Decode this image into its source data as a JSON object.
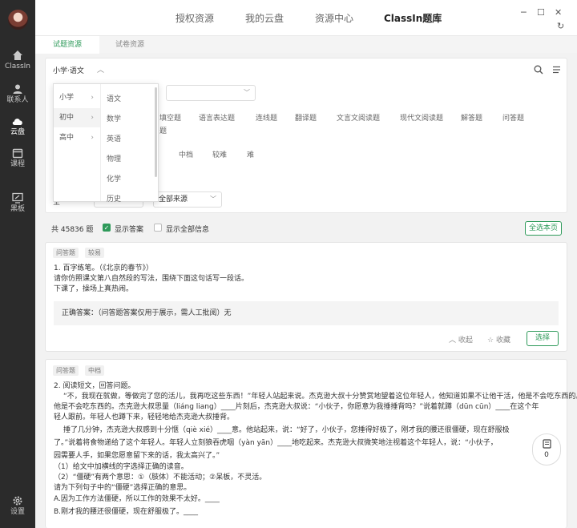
{
  "sidebar": {
    "items": [
      {
        "label": "ClassIn",
        "icon": "home-icon"
      },
      {
        "label": "联系人",
        "icon": "contacts-icon"
      },
      {
        "label": "云盘",
        "icon": "cloud-icon"
      },
      {
        "label": "课程",
        "icon": "calendar-icon"
      },
      {
        "label": "黑板",
        "icon": "blackboard-icon"
      }
    ],
    "settings": "设置"
  },
  "top_tabs": [
    "授权资源",
    "我的云盘",
    "资源中心",
    "ClassIn题库"
  ],
  "sub_tabs": [
    "试题资源",
    "试卷资源"
  ],
  "filter": {
    "selected_subject": "小学·语文",
    "types": [
      "填空题",
      "语言表达题",
      "连线题",
      "翻译题",
      "文言文阅读题",
      "现代文阅读题",
      "解答题",
      "问答题"
    ],
    "types_row2": "题",
    "difficulty": [
      "中档",
      "较难",
      "难"
    ],
    "source_label": "全",
    "source_select": "全部地区",
    "source_select2": "全部来源"
  },
  "dropdown": {
    "levels": [
      "小学",
      "初中",
      "高中"
    ],
    "subjects": [
      "语文",
      "数学",
      "英语",
      "物理",
      "化学",
      "历史"
    ]
  },
  "count_text": "共 45836 题",
  "show_answer": "显示答案",
  "show_all": "显示全部信息",
  "select_page": "全选本页",
  "question1": {
    "tags": [
      "问答题",
      "较易"
    ],
    "lines": [
      "1. 百字练笔。（《北京的春节》）",
      "请你仿照课文第八自然段的写法，围绕下面这句话写一段话。",
      "下课了，操场上真热闹。"
    ],
    "answer": "正确答案：（问答题答案仅用于展示，需人工批阅）无",
    "collapse": "收起",
    "favorite": "收藏",
    "select": "选择"
  },
  "question2": {
    "tags": [
      "问答题",
      "中档"
    ],
    "lines": [
      "2. 阅读短文，回答问题。",
      "“不，我现在就做，等做完了您的活儿，我再吃这些东西！”年轻人站起来说。杰克逊大叔十分赞赏地望着这位年轻人，他知道如果不让他干活，他是不会吃东西的。",
      "他是不会吃东西的。杰克逊大叔思量（liáng liang）____片刻后，杰克逊大叔说：“小伙子，你愿意为我捶捶背吗？”说着就蹲（dūn cūn）____在这个年",
      "轻人跟前。年轻人也蹲下来，轻轻地给杰克逊大叔捶背。",
      "捶了几分钟，杰克逊大叔感到十分惬（qiè xié）____意。他站起来，说：“好了，小伙子，您捶得好极了，刚才我的腰还很僵硬，现在舒服极",
      "了。”说着将食物递给了这个年轻人。年轻人立刻狼吞虎咽（yàn yān）____地吃起来。杰克逊大叔微笑地注视着这个年轻人，说：“小伙子，",
      "园需要人手，如果您愿意留下来的话，我太高兴了。”",
      "（1）给文中加横线的字选择正确的读音。",
      "（2）“僵硬”有两个意思：①（肢体）不能活动；②呆板，不灵活。",
      "请为下列句子中的“僵硬”选择正确的意思。",
      "A.因为工作方法僵硬，所以工作的效果不太好。____",
      "B.刚才我的腰还很僵硬，现在舒服极了。____"
    ]
  },
  "basket_count": "0"
}
